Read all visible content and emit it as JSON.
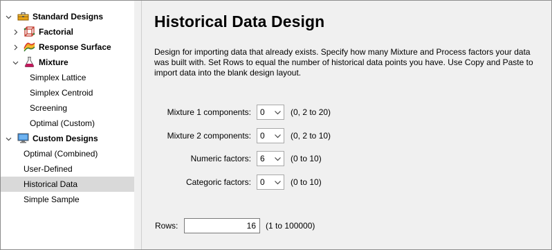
{
  "tree": {
    "standard_designs": "Standard Designs",
    "factorial": "Factorial",
    "response_surface": "Response Surface",
    "mixture": "Mixture",
    "simplex_lattice": "Simplex Lattice",
    "simplex_centroid": "Simplex Centroid",
    "screening": "Screening",
    "optimal_custom": "Optimal (Custom)",
    "custom_designs": "Custom Designs",
    "optimal_combined": "Optimal (Combined)",
    "user_defined": "User-Defined",
    "historical_data": "Historical Data",
    "simple_sample": "Simple Sample",
    "selected_item": "Historical Data"
  },
  "main": {
    "title": "Historical Data Design",
    "description": "Design for importing data that already exists. Specify how many Mixture and Process factors your data was built with. Set Rows to equal the number of historical data points you have. Use Copy and Paste to import data into the blank design layout.",
    "fields": [
      {
        "label": "Mixture 1 components:",
        "value": "0",
        "range": "(0, 2 to 20)"
      },
      {
        "label": "Mixture 2 components:",
        "value": "0",
        "range": "(0, 2 to 10)"
      },
      {
        "label": "Numeric factors:",
        "value": "6",
        "range": "(0 to 10)"
      },
      {
        "label": "Categoric factors:",
        "value": "0",
        "range": "(0 to 10)"
      }
    ],
    "rows": {
      "label": "Rows:",
      "value": "16",
      "range": "(1 to 100000)"
    }
  },
  "icons": {
    "standard_designs": "toolbox-icon",
    "factorial": "cube-icon",
    "response_surface": "surface-icon",
    "mixture": "flask-icon",
    "custom_designs": "monitor-icon",
    "expand": "chevron-right-icon",
    "collapse": "chevron-down-icon"
  },
  "colors": {
    "selection": "#d9d9d9",
    "pane_background": "#f0f0f0",
    "toolbox": "#e8a317",
    "cube": "#c0392b",
    "flask": "#c2185b",
    "monitor": "#2e7fd1"
  }
}
